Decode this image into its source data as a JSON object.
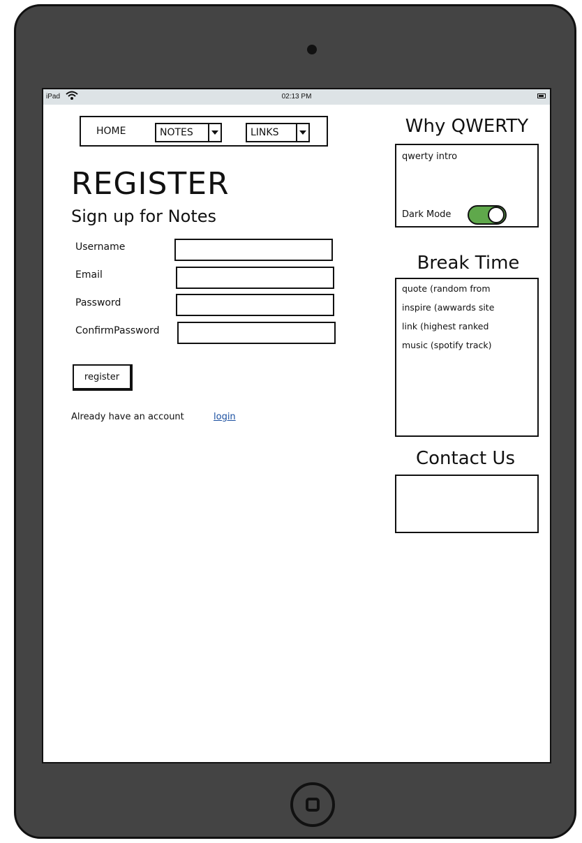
{
  "statusbar": {
    "carrier": "iPad",
    "time": "02:13 PM"
  },
  "nav": {
    "home": "HOME",
    "notes": "NOTES",
    "links": "LINKS"
  },
  "page": {
    "title": "REGISTER",
    "subtitle": "Sign up for Notes"
  },
  "form": {
    "username_label": "Username",
    "email_label": "Email",
    "password_label": "Password",
    "confirm_label": "ConfirmPassword",
    "username_value": "",
    "email_value": "",
    "password_value": "",
    "confirm_value": "",
    "register_label": "register"
  },
  "login_prompt": {
    "text": "Already have an account",
    "link": "login"
  },
  "sidebar": {
    "why_title": "Why QWERTY",
    "intro_text": "qwerty intro",
    "dark_mode_label": "Dark Mode",
    "dark_mode_on": true,
    "break_title": "Break Time",
    "break_lines": [
      "quote (random from",
      "inspire (awwards site",
      "link (highest ranked",
      "music (spotify track)"
    ],
    "contact_title": "Contact Us"
  },
  "colors": {
    "toggle_on": "#5fa84b",
    "link": "#1a4fa0",
    "device": "#444444",
    "statusbar": "#dde3e6"
  },
  "icons": [
    "wifi-icon",
    "battery-icon",
    "chevron-down-icon",
    "home-button-icon"
  ]
}
